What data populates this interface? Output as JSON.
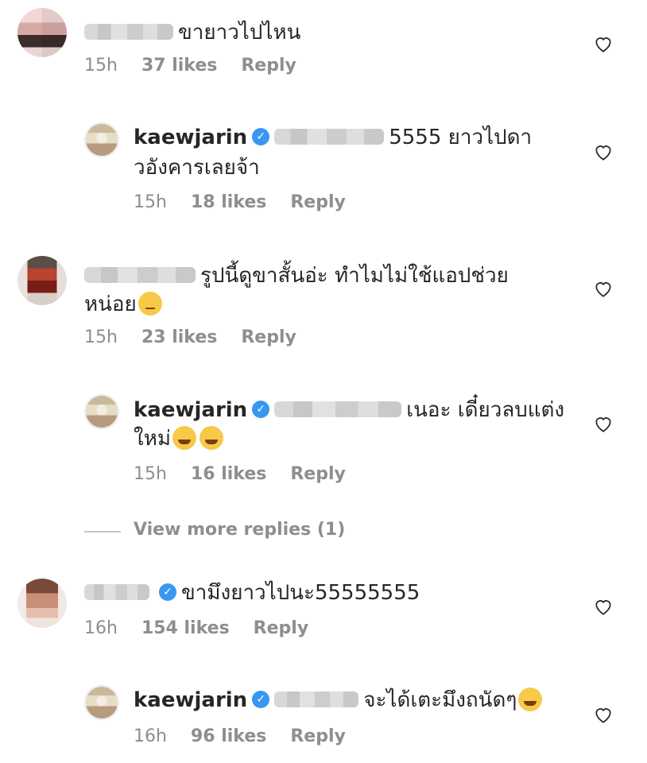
{
  "comments": [
    {
      "text": "ขายาวไปไหน",
      "time": "15h",
      "likes": "37 likes",
      "reply_label": "Reply",
      "icon": "heart-outline"
    },
    {
      "username": "kaewjarin",
      "text_line1": "5555 ยาวไปดา",
      "text_line2": "วอังคารเลยจ้า",
      "time": "15h",
      "likes": "18 likes",
      "reply_label": "Reply",
      "icon": "heart-outline"
    },
    {
      "text_line1": "รูปนี้ดูขาสั้นอ่ะ ทำไมไม่ใช้แอปช่วย",
      "text_line2": "หน่อย",
      "time": "15h",
      "likes": "23 likes",
      "reply_label": "Reply",
      "icon": "heart-outline"
    },
    {
      "username": "kaewjarin",
      "text_line1": "เนอะ เดี๋ยวลบแต่ง",
      "text_line2": "ใหม่",
      "time": "15h",
      "likes": "16 likes",
      "reply_label": "Reply",
      "icon": "heart-outline"
    },
    {
      "text": "ขามึงยาวไปนะ55555555",
      "time": "16h",
      "likes": "154 likes",
      "reply_label": "Reply",
      "icon": "heart-outline"
    },
    {
      "username": "kaewjarin",
      "text": "จะได้เตะมึงถนัดๆ",
      "time": "16h",
      "likes": "96 likes",
      "reply_label": "Reply",
      "icon": "heart-outline"
    }
  ],
  "view_more": "View more replies (1)",
  "colors": {
    "text": "#262626",
    "meta": "#8e8e8e",
    "verified": "#3897f0"
  }
}
